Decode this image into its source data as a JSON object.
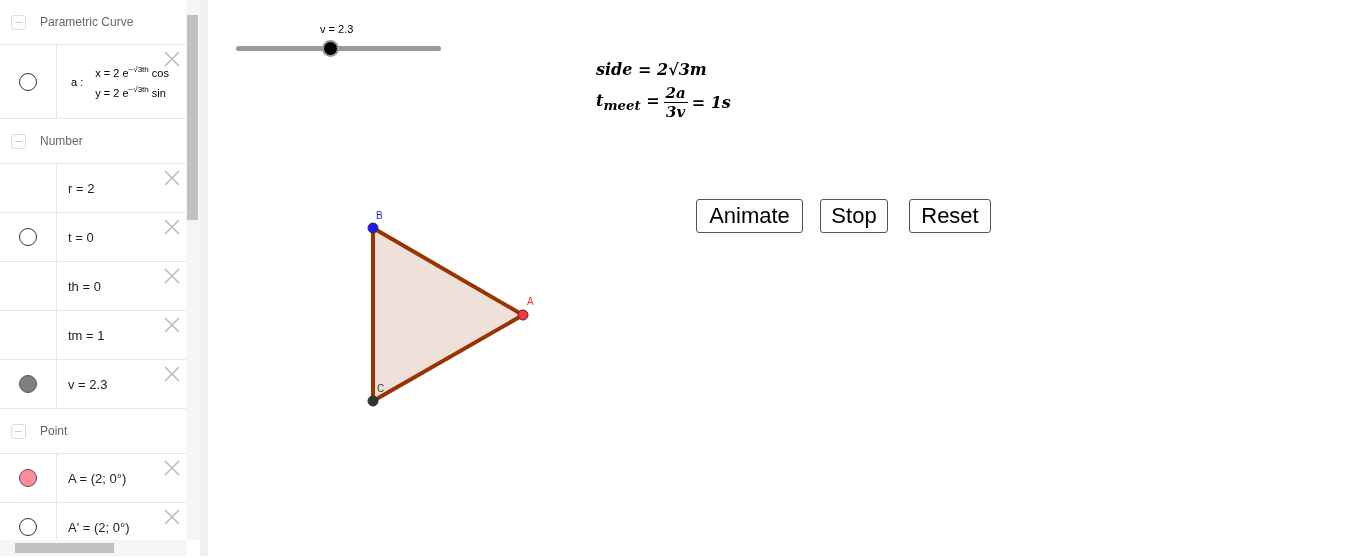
{
  "algebra": {
    "groups": [
      {
        "title": "Parametric Curve",
        "items": [
          {
            "kind": "curve",
            "name": "a :",
            "lines": [
              "x = 2 e$^{−√3th}$ cos",
              "y = 2 e$^{−√3th}$ sin"
            ],
            "marker": {
              "filled": false
            }
          }
        ]
      },
      {
        "title": "Number",
        "items": [
          {
            "kind": "text",
            "text": "r = 2"
          },
          {
            "kind": "text",
            "text": "t = 0",
            "marker": {
              "filled": false
            }
          },
          {
            "kind": "text",
            "text": "th = 0"
          },
          {
            "kind": "text",
            "text": "tm = 1"
          },
          {
            "kind": "text",
            "text": "v = 2.3",
            "marker": {
              "filled": true,
              "color": "#808080"
            }
          }
        ]
      },
      {
        "title": "Point",
        "items": [
          {
            "kind": "text",
            "text": "A = (2; 0°)",
            "marker": {
              "filled": true,
              "color": "#ff8c9a"
            }
          },
          {
            "kind": "text",
            "text": "A' = (2; 0°)",
            "marker": {
              "filled": false
            }
          }
        ]
      }
    ]
  },
  "slider": {
    "label": "v = 2.3",
    "level": 0.46
  },
  "formulas": {
    "side": "side = 2√3m",
    "meet": {
      "lhs": "t$_{meet}$ =",
      "numerator": "2a",
      "denominator": "3v",
      "rhs": "= 1s"
    }
  },
  "points": [
    {
      "label": "B",
      "color": "#1a1aff"
    },
    {
      "label": "A",
      "color": "#ff3040"
    },
    {
      "label": "C",
      "color": "#333333"
    }
  ],
  "buttons": [
    "Animate",
    "Stop",
    "Reset"
  ]
}
